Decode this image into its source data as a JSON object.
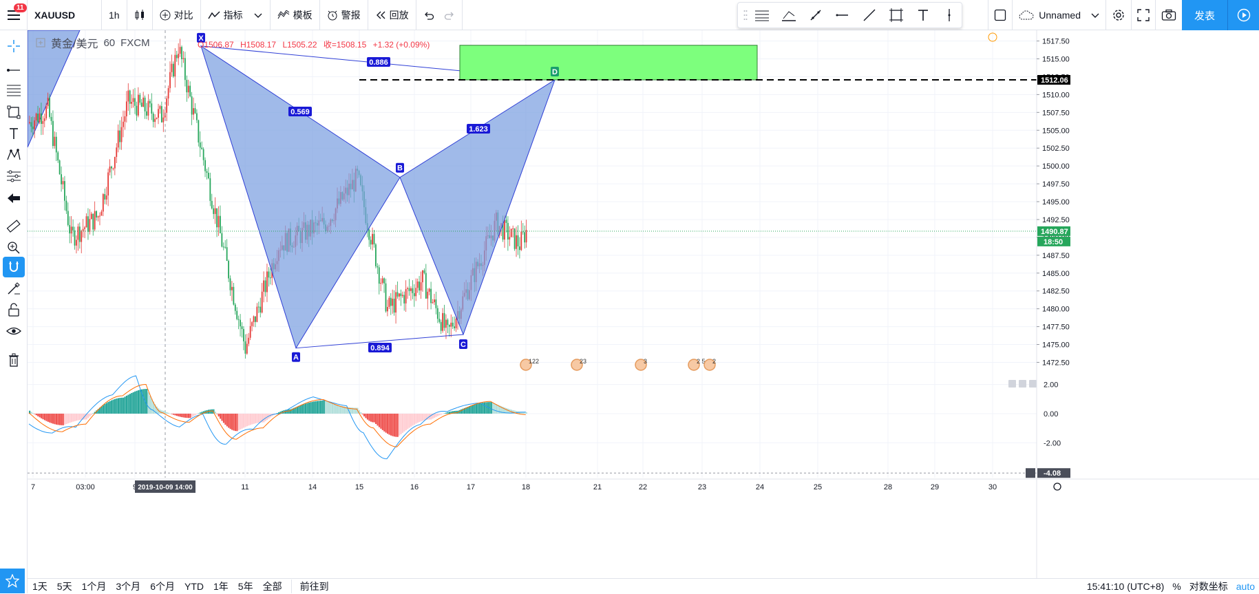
{
  "toolbar": {
    "menu_badge": "11",
    "symbol": "XAUUSD",
    "interval": "1h",
    "compare": "对比",
    "indicators": "指标",
    "templates": "模板",
    "alert": "警报",
    "replay": "回放",
    "layout_name": "Unnamed",
    "publish": "发表"
  },
  "legend": {
    "name": "黄金/美元",
    "interval": "60",
    "exchange": "FXCM",
    "open": "O1506.87",
    "high": "H1508.17",
    "low": "L1505.22",
    "close": "收=1508.15",
    "change": "+1.32 (+0.09%)"
  },
  "chart_data": {
    "type": "candlestick",
    "symbol": "XAUUSD",
    "interval": "60",
    "price_axis": {
      "ticks": [
        1472.5,
        1475.0,
        1477.5,
        1480.0,
        1482.5,
        1485.0,
        1487.5,
        1490.0,
        1492.5,
        1495.0,
        1497.5,
        1500.0,
        1502.5,
        1505.0,
        1507.5,
        1510.0,
        1512.5,
        1515.0,
        1517.5
      ],
      "tick_labels": [
        "1472.50",
        "1475.00",
        "1477.50",
        "1480.00",
        "1482.50",
        "1485.00",
        "1487.50",
        "1490.00",
        "1492.50",
        "1495.00",
        "1497.50",
        "1500.00",
        "1502.50",
        "1505.00",
        "1507.50",
        "1510.00",
        "1512.50",
        "1515.00",
        "1517.50"
      ],
      "range": [
        1471,
        1519
      ],
      "current_price_label": "1490.87",
      "countdown_label": "18:50",
      "line_price_label": "1512.06",
      "current_price": 1490.87,
      "line_price": 1512.06
    },
    "time_axis": {
      "labels": [
        "7",
        "03:00",
        "9",
        "11",
        "14",
        "15",
        "16",
        "17",
        "18",
        "21",
        "22",
        "23",
        "24",
        "25",
        "28",
        "29",
        "30"
      ],
      "crosshair_label": "2019-10-09  14:00"
    },
    "pattern": {
      "points": [
        {
          "label": "X",
          "price": 1516.8
        },
        {
          "label": "A",
          "price": 1474.5
        },
        {
          "label": "B",
          "price": 1498.4
        },
        {
          "label": "C",
          "price": 1476.4
        },
        {
          "label": "D",
          "price": 1512.06
        }
      ],
      "ratios": [
        "0.886",
        "0.569",
        "1.623",
        "0.894"
      ]
    },
    "target_zone": {
      "price_top": 1516.9,
      "price_bottom": 1512.06
    },
    "macd": {
      "ticks": [
        2.0,
        0.0,
        -2.0
      ],
      "tick_labels": [
        "2.00",
        "0.00",
        "-2.00"
      ],
      "range": [
        -4.4,
        2.6
      ],
      "current_label": "-4.08"
    },
    "events": [
      "122",
      "23",
      "3",
      "2",
      "5",
      "2"
    ]
  },
  "bottom": {
    "ranges": [
      "1天",
      "5天",
      "1个月",
      "3个月",
      "6个月",
      "YTD",
      "1年",
      "5年",
      "全部"
    ],
    "goto": "前往到",
    "time": "15:41:10 (UTC+8)",
    "percent": "%",
    "log": "对数坐标",
    "auto": "auto"
  },
  "colors": {
    "up": "#e53935",
    "down": "#26a65b",
    "pattern_fill": "#7b9fe0",
    "pattern_stroke": "#2f3fd6",
    "zone_fill": "#7dff7d",
    "accent": "#2196f3"
  }
}
